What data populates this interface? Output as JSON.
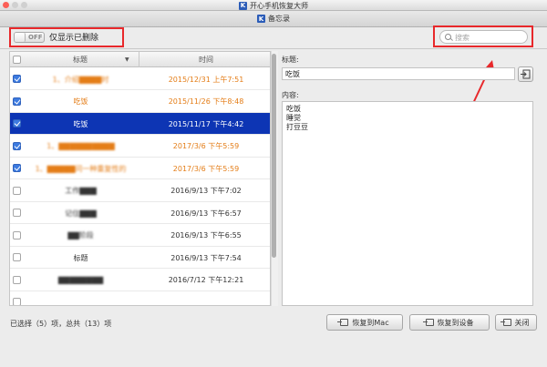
{
  "app": {
    "outer_title": "开心手机恢复大师",
    "window_title": "备忘录",
    "app_icon_letter": "K"
  },
  "toolbar": {
    "toggle_label": "OFF",
    "only_deleted_label": "仅显示已删除",
    "search_placeholder": "搜索"
  },
  "table": {
    "col_title": "标题",
    "col_time": "时间",
    "rows": [
      {
        "title": "1、介绍▇▇▇▇时",
        "time": "2015/12/31 上午7:51",
        "checked": true,
        "color": "orange",
        "selected": false
      },
      {
        "title": "吃饭",
        "time": "2015/11/26 下午8:48",
        "checked": true,
        "color": "orange",
        "selected": false
      },
      {
        "title": "吃饭",
        "time": "2015/11/17 下午4:42",
        "checked": true,
        "color": "white",
        "selected": true
      },
      {
        "title": "1、▇▇▇▇▇▇▇▇▇▇",
        "time": "2017/3/6 下午5:59",
        "checked": true,
        "color": "orange",
        "selected": false
      },
      {
        "title": "1、▇▇▇▇▇问一种重复性的",
        "time": "2017/3/6 下午5:59",
        "checked": true,
        "color": "orange",
        "selected": false
      },
      {
        "title": "工作▇▇▇",
        "time": "2016/9/13 下午7:02",
        "checked": false,
        "color": "dark",
        "selected": false
      },
      {
        "title": "记住▇▇▇",
        "time": "2016/9/13 下午6:57",
        "checked": false,
        "color": "dark",
        "selected": false
      },
      {
        "title": "▇▇阶段",
        "time": "2016/9/13 下午6:55",
        "checked": false,
        "color": "dark",
        "selected": false
      },
      {
        "title": "标题",
        "time": "2016/9/13 下午7:54",
        "checked": false,
        "color": "dark",
        "selected": false
      },
      {
        "title": "▇▇▇▇▇▇▇▇",
        "time": "2016/7/12 下午12:21",
        "checked": false,
        "color": "dark",
        "selected": false
      },
      {
        "title": "",
        "time": "",
        "checked": false,
        "color": "dark",
        "selected": false
      }
    ]
  },
  "detail": {
    "title_label": "标题:",
    "title_value": "吃饭",
    "content_label": "内容:",
    "content_lines": [
      "吃饭",
      "睡觉",
      "打豆豆"
    ]
  },
  "footer": {
    "status": "已选择（5）项，总共（13）项",
    "restore_mac": "恢复到Mac",
    "restore_device": "恢复到设备",
    "close": "关闭"
  },
  "colors": {
    "accent_selected": "#0d35b4",
    "orange_text": "#e47d17",
    "annotation_red": "#e8282b"
  }
}
